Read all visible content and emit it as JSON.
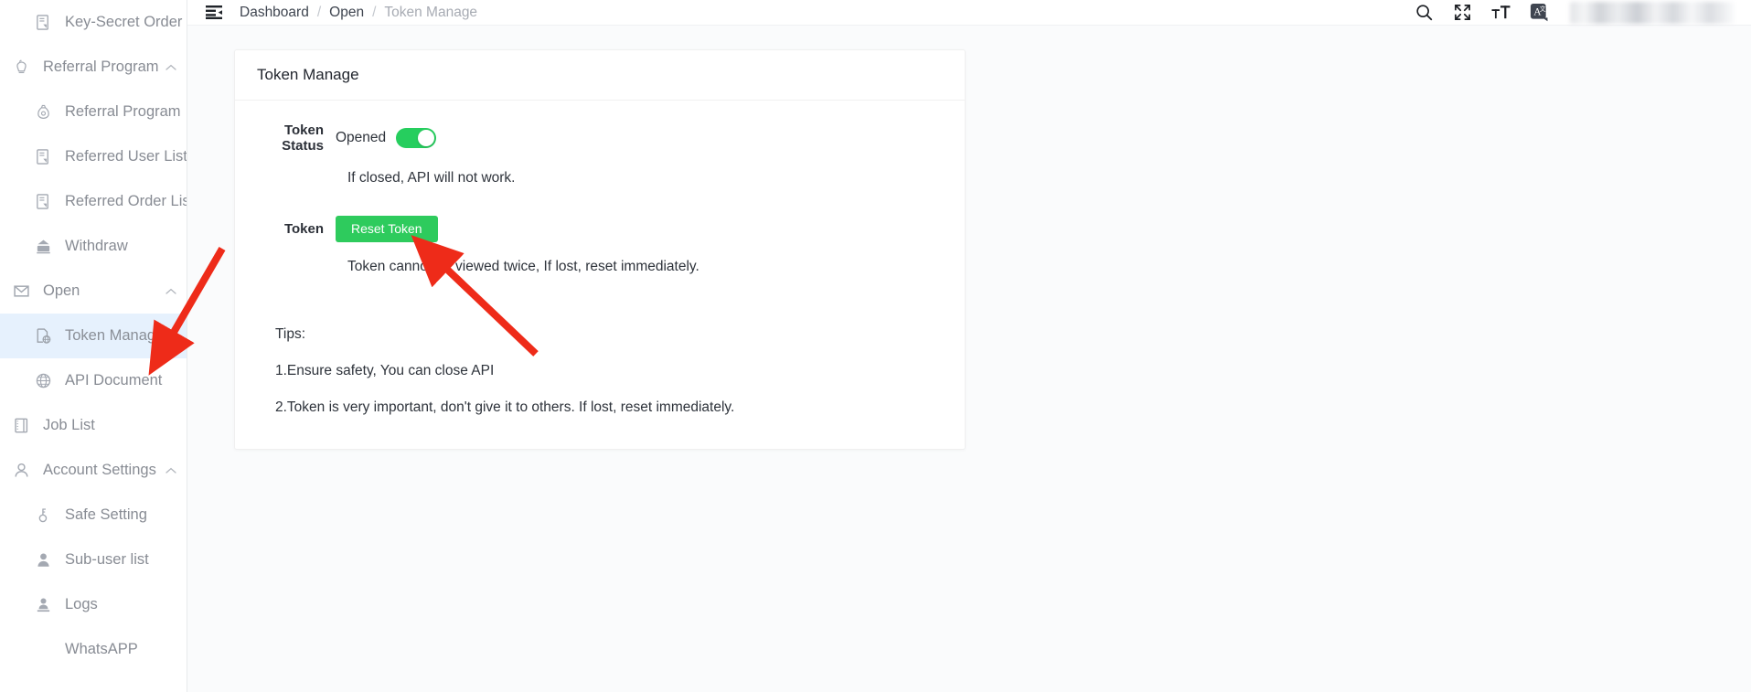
{
  "sidebar": {
    "items": [
      {
        "label": "Key-Secret Order",
        "icon": "file-list-icon",
        "level": "child",
        "type": "link",
        "active": false
      },
      {
        "label": "Referral Program",
        "icon": "gift-icon",
        "level": "group",
        "type": "group",
        "active": false,
        "expanded": true
      },
      {
        "label": "Referral Program",
        "icon": "money-bag-icon",
        "level": "child",
        "type": "link",
        "active": false
      },
      {
        "label": "Referred User List",
        "icon": "file-list-icon",
        "level": "child",
        "type": "link",
        "active": false
      },
      {
        "label": "Referred Order List",
        "icon": "file-list-icon",
        "level": "child",
        "type": "link",
        "active": false
      },
      {
        "label": "Withdraw",
        "icon": "bank-icon",
        "level": "child",
        "type": "link",
        "active": false
      },
      {
        "label": "Open",
        "icon": "mail-icon",
        "level": "group",
        "type": "group",
        "active": false,
        "expanded": true
      },
      {
        "label": "Token Manage",
        "icon": "token-page-icon",
        "level": "child",
        "type": "link",
        "active": true
      },
      {
        "label": "API Document",
        "icon": "globe-icon",
        "level": "child",
        "type": "link",
        "active": false
      },
      {
        "label": "Job List",
        "icon": "book-icon",
        "level": "plain",
        "type": "link",
        "active": false
      },
      {
        "label": "Account Settings",
        "icon": "user-outline-icon",
        "level": "group",
        "type": "group",
        "active": false,
        "expanded": true
      },
      {
        "label": "Safe Setting",
        "icon": "key-icon",
        "level": "child",
        "type": "link",
        "active": false
      },
      {
        "label": "Sub-user list",
        "icon": "user-solid-icon",
        "level": "child",
        "type": "link",
        "active": false
      },
      {
        "label": "Logs",
        "icon": "user-stamp-icon",
        "level": "child",
        "type": "link",
        "active": false
      },
      {
        "label": "WhatsAPP",
        "icon": "",
        "level": "no-icon",
        "type": "link",
        "active": false
      }
    ]
  },
  "topbar": {
    "fold_icon": "menu-fold-icon",
    "breadcrumb": [
      {
        "label": "Dashboard",
        "current": false
      },
      {
        "label": "Open",
        "current": false
      },
      {
        "label": "Token Manage",
        "current": true
      }
    ],
    "separator": "/",
    "actions": [
      {
        "icon": "search-icon",
        "label": "Search"
      },
      {
        "icon": "fullscreen-icon",
        "label": "Fullscreen"
      },
      {
        "icon": "font-size-icon",
        "label": "Font size"
      },
      {
        "icon": "translate-icon",
        "label": "Language"
      }
    ],
    "user_area": "blurred-user-account"
  },
  "card": {
    "title": "Token Manage",
    "token_status": {
      "label": "Token Status",
      "value": "Opened",
      "switch_on": true,
      "hint": "If closed, API will not work."
    },
    "token": {
      "label": "Token",
      "button_label": "Reset Token",
      "hint": "Token cannot be viewed twice, If lost, reset immediately."
    },
    "tips": {
      "heading": "Tips:",
      "lines": [
        "1.Ensure safety, You can close API",
        "2.Token is very important, don't give it to others. If lost, reset immediately."
      ]
    }
  },
  "colors": {
    "accent_green": "#2ecb5d",
    "switch_green": "#26ce5e",
    "active_item_bg": "#e6f1fd",
    "annotation_red": "#ee2b19",
    "text_primary": "#2e333b",
    "text_muted": "#888c94",
    "page_bg": "#fafbfc"
  },
  "annotations": [
    {
      "name": "arrow-to-token-manage",
      "color": "#ee2b19"
    },
    {
      "name": "arrow-to-reset-token",
      "color": "#ee2b19"
    }
  ]
}
